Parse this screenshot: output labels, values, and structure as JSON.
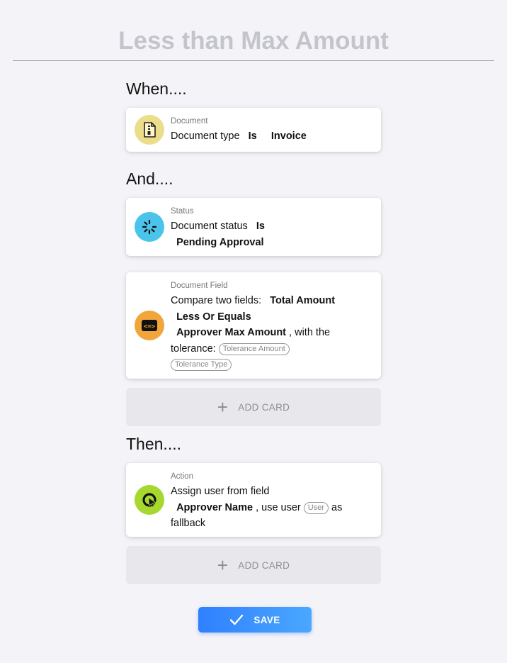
{
  "page": {
    "title": "Less than Max Amount"
  },
  "sections": {
    "when": "When....",
    "and": "And....",
    "then": "Then...."
  },
  "cards": {
    "document": {
      "category": "Document",
      "icon": "document-zip-icon",
      "icon_bg": "#ecdd8a",
      "line1": {
        "text": "Document type",
        "op": "Is",
        "value": "Invoice"
      }
    },
    "status": {
      "category": "Status",
      "icon": "spinner-icon",
      "icon_bg": "#4ac4ea",
      "line1": {
        "text": "Document status",
        "op": "Is"
      },
      "line2": {
        "value": "Pending Approval"
      }
    },
    "field": {
      "category": "Document Field",
      "icon": "compare-arrows-icon",
      "icon_bg": "#f1a53a",
      "line1": {
        "text": "Compare two fields:",
        "field1": "Total Amount"
      },
      "line2": {
        "op": "Less Or Equals"
      },
      "line3": {
        "field2": "Approver Max Amount",
        "suffix": ", with the"
      },
      "line4": {
        "text": "tolerance:",
        "pill": "Tolerance Amount"
      },
      "line5": {
        "pill": "Tolerance Type"
      }
    },
    "action": {
      "category": "Action",
      "icon": "assign-cursor-icon",
      "icon_bg": "#a6d82f",
      "line1": {
        "text": "Assign user from field"
      },
      "line2": {
        "field": "Approver Name",
        "mid": ", use user",
        "pill": "User",
        "suffix": "as"
      },
      "line3": {
        "text": "fallback"
      }
    }
  },
  "add_card_label": "ADD CARD",
  "save_label": "SAVE",
  "colors": {
    "accent": "#2f80ff",
    "accent_end": "#4aa8ff",
    "background": "#f4f4f8"
  }
}
